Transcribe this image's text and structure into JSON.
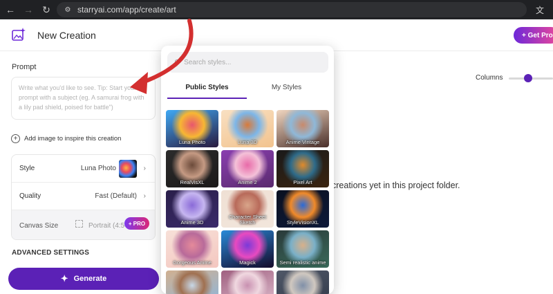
{
  "browser": {
    "url": "starryai.com/app/create/art"
  },
  "header": {
    "title": "New Creation",
    "get_pro_label": "+ Get Pro"
  },
  "prompt": {
    "label": "Prompt",
    "placeholder": "Write what you'd like to see.  Tip: Start your prompt with a subject (eg. A samurai frog with a lily pad shield, poised for battle\")"
  },
  "add_image_label": "Add image to inspire this creation",
  "settings": {
    "style_label": "Style",
    "style_value": "Luna Photo",
    "quality_label": "Quality",
    "quality_value": "Fast (Default)",
    "canvas_label": "Canvas Size",
    "canvas_value": "Portrait (4:5",
    "pro_badge": "+ PRO"
  },
  "advanced_label": "ADVANCED SETTINGS",
  "generate_label": "Generate",
  "main": {
    "columns_label": "Columns",
    "empty_message": "creations yet in this project folder."
  },
  "styles_popover": {
    "search_placeholder": "Search styles...",
    "tab_public": "Public Styles",
    "tab_mine": "My Styles",
    "tiles": [
      {
        "label": "Luna Photo",
        "colors": [
          "#2a1a3e",
          "#e8566e",
          "#f7b733",
          "#3fa9f5"
        ]
      },
      {
        "label": "Luna 3D",
        "colors": [
          "#f2c38e",
          "#d87a3a",
          "#7db6e8",
          "#f9e0c2"
        ]
      },
      {
        "label": "Anime Vintage",
        "colors": [
          "#4a2f2a",
          "#c98a6b",
          "#8fb8d8",
          "#f0d6c0"
        ]
      },
      {
        "label": "RealVisXL",
        "colors": [
          "#1c1a1a",
          "#6b4a3a",
          "#c59a83",
          "#2b2b2b"
        ]
      },
      {
        "label": "Anime 2",
        "colors": [
          "#5a2a6e",
          "#e86aa8",
          "#f4c1d8",
          "#8a3fb0"
        ]
      },
      {
        "label": "Pixel Art",
        "colors": [
          "#3a2410",
          "#e08a2a",
          "#2e6b8a",
          "#1a1a1a"
        ]
      },
      {
        "label": "Anime 3D",
        "colors": [
          "#3a2a6a",
          "#8a6ad8",
          "#c6b6f0",
          "#2a1f4a"
        ]
      },
      {
        "label": "Character Sheet Sketch",
        "colors": [
          "#f2e6dc",
          "#d9a58a",
          "#b86a5a",
          "#efe0d4"
        ]
      },
      {
        "label": "StyleVisionXL",
        "colors": [
          "#0e1a3a",
          "#2a6ad8",
          "#f08a2a",
          "#0a1020"
        ]
      },
      {
        "label": "Gorgeous Anime",
        "colors": [
          "#f4c7c0",
          "#e58a9a",
          "#b86a9a",
          "#f7e0d8"
        ]
      },
      {
        "label": "Magick",
        "colors": [
          "#140a2a",
          "#7a3ad8",
          "#e84ac0",
          "#2a8ad8"
        ]
      },
      {
        "label": "Semi realistic anime",
        "colors": [
          "#3a6a5a",
          "#d8b08a",
          "#7ab0c8",
          "#2a3a3a"
        ]
      },
      {
        "label": "",
        "colors": [
          "#8ab6e0",
          "#c8d8e8",
          "#a07050",
          "#d0b090"
        ]
      },
      {
        "label": "",
        "colors": [
          "#e0c0d0",
          "#c890b0",
          "#f0d8e0",
          "#a06080"
        ]
      },
      {
        "label": "",
        "colors": [
          "#303848",
          "#8090a8",
          "#d0c8c0",
          "#505868"
        ]
      }
    ]
  }
}
